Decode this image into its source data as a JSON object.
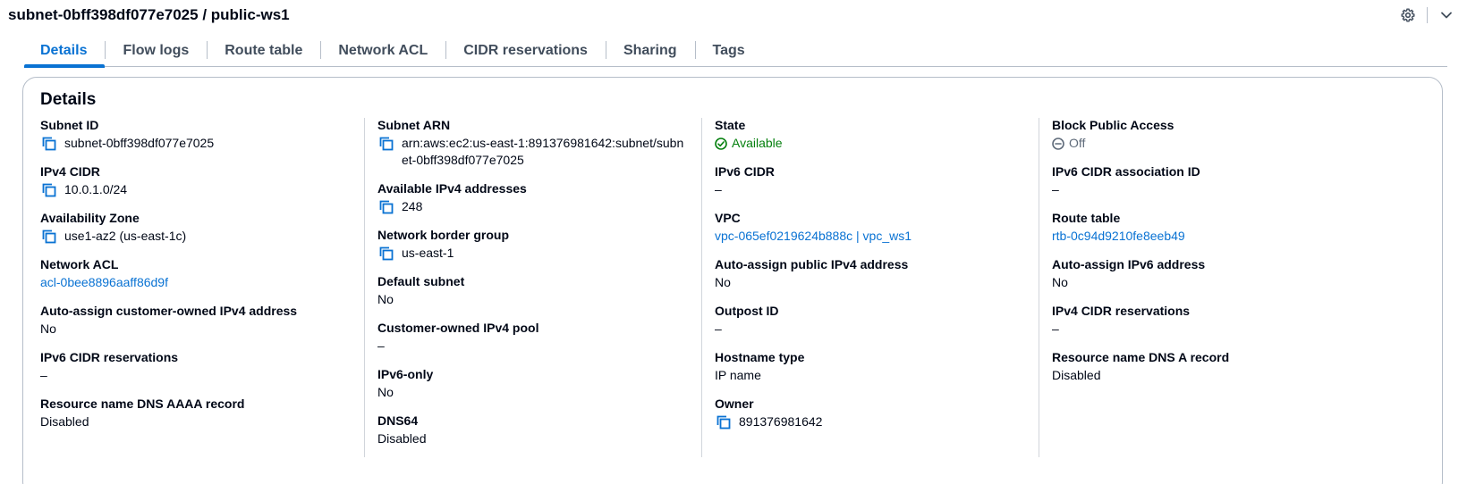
{
  "header": {
    "title": "subnet-0bff398df077e7025 / public-ws1"
  },
  "tabs": [
    {
      "label": "Details",
      "active": true
    },
    {
      "label": "Flow logs"
    },
    {
      "label": "Route table"
    },
    {
      "label": "Network ACL"
    },
    {
      "label": "CIDR reservations"
    },
    {
      "label": "Sharing"
    },
    {
      "label": "Tags"
    }
  ],
  "details": {
    "title": "Details",
    "col1": {
      "subnet_id": {
        "label": "Subnet ID",
        "value": "subnet-0bff398df077e7025"
      },
      "ipv4_cidr": {
        "label": "IPv4 CIDR",
        "value": "10.0.1.0/24"
      },
      "availability_zone": {
        "label": "Availability Zone",
        "value": "use1-az2 (us-east-1c)"
      },
      "network_acl": {
        "label": "Network ACL",
        "value": "acl-0bee8896aaff86d9f"
      },
      "auto_assign_customer_ipv4": {
        "label": "Auto-assign customer-owned IPv4 address",
        "value": "No"
      },
      "ipv6_cidr_reservations": {
        "label": "IPv6 CIDR reservations",
        "value": "–"
      },
      "dns_aaaa": {
        "label": "Resource name DNS AAAA record",
        "value": "Disabled"
      }
    },
    "col2": {
      "subnet_arn": {
        "label": "Subnet ARN",
        "value": "arn:aws:ec2:us-east-1:891376981642:subnet/subnet-0bff398df077e7025"
      },
      "available_ipv4": {
        "label": "Available IPv4 addresses",
        "value": "248"
      },
      "network_border_group": {
        "label": "Network border group",
        "value": "us-east-1"
      },
      "default_subnet": {
        "label": "Default subnet",
        "value": "No"
      },
      "customer_ipv4_pool": {
        "label": "Customer-owned IPv4 pool",
        "value": "–"
      },
      "ipv6_only": {
        "label": "IPv6-only",
        "value": "No"
      },
      "dns64": {
        "label": "DNS64",
        "value": "Disabled"
      }
    },
    "col3": {
      "state": {
        "label": "State",
        "value": "Available"
      },
      "ipv6_cidr": {
        "label": "IPv6 CIDR",
        "value": "–"
      },
      "vpc": {
        "label": "VPC",
        "value": "vpc-065ef0219624b888c | vpc_ws1"
      },
      "auto_assign_public_ipv4": {
        "label": "Auto-assign public IPv4 address",
        "value": "No"
      },
      "outpost_id": {
        "label": "Outpost ID",
        "value": "–"
      },
      "hostname_type": {
        "label": "Hostname type",
        "value": "IP name"
      },
      "owner": {
        "label": "Owner",
        "value": "891376981642"
      }
    },
    "col4": {
      "block_public_access": {
        "label": "Block Public Access",
        "value": "Off"
      },
      "ipv6_cidr_association_id": {
        "label": "IPv6 CIDR association ID",
        "value": "–"
      },
      "route_table": {
        "label": "Route table",
        "value": "rtb-0c94d9210fe8eeb49"
      },
      "auto_assign_ipv6": {
        "label": "Auto-assign IPv6 address",
        "value": "No"
      },
      "ipv4_cidr_reservations": {
        "label": "IPv4 CIDR reservations",
        "value": "–"
      },
      "dns_a": {
        "label": "Resource name DNS A record",
        "value": "Disabled"
      }
    }
  },
  "colors": {
    "link": "#0972d3",
    "success": "#037f0c",
    "muted": "#5f6b7a"
  },
  "icons": [
    "copy-icon",
    "check-circle-icon",
    "minus-circle-icon",
    "gear-icon",
    "chevron-down-icon"
  ]
}
